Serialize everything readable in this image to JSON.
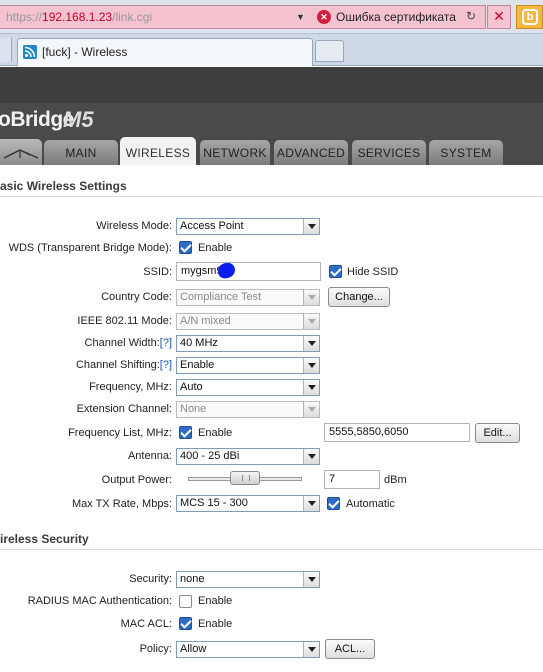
{
  "browser": {
    "url_prefix": "https://",
    "url_host": "192.168.1.23",
    "url_path": "/link.cgi",
    "cert_error": "Ошибка сертификата",
    "tab_title": "[fuck] - Wireless"
  },
  "header": {
    "brand": "oBridge",
    "model": "M5"
  },
  "nav": {
    "tabs": [
      "MAIN",
      "WIRELESS",
      "NETWORK",
      "ADVANCED",
      "SERVICES",
      "SYSTEM"
    ],
    "active": "WIRELESS"
  },
  "basic": {
    "title": "asic Wireless Settings",
    "wireless_mode_label": "Wireless Mode:",
    "wireless_mode_value": "Access Point",
    "wds_label": "WDS (Transparent Bridge Mode):",
    "wds_enable_text": "Enable",
    "ssid_label": "SSID:",
    "ssid_value": "mygsm9",
    "hide_ssid_text": "Hide SSID",
    "country_label": "Country Code:",
    "country_value": "Compliance Test",
    "change_button": "Change...",
    "ieee_label": "IEEE 802.11 Mode:",
    "ieee_value": "A/N mixed",
    "channel_width_label": "Channel Width:",
    "channel_width_help": "[?]",
    "channel_width_value": "40 MHz",
    "channel_shifting_label": "Channel Shifting:",
    "channel_shifting_help": "[?]",
    "channel_shifting_value": "Enable",
    "frequency_label": "Frequency, MHz:",
    "frequency_value": "Auto",
    "extension_label": "Extension Channel:",
    "extension_value": "None",
    "freq_list_label": "Frequency List, MHz:",
    "freq_list_enable_text": "Enable",
    "freq_list_value": "5555,5850,6050",
    "edit_button": "Edit...",
    "antenna_label": "Antenna:",
    "antenna_value": "400 - 25 dBi",
    "output_power_label": "Output Power:",
    "output_power_value": "7",
    "output_power_unit": "dBm",
    "max_tx_label": "Max TX Rate, Mbps:",
    "max_tx_value": "MCS 15 - 300",
    "automatic_text": "Automatic"
  },
  "security": {
    "title": "ireless Security",
    "security_label": "Security:",
    "security_value": "none",
    "radius_label": "RADIUS MAC Authentication:",
    "radius_enable_text": "Enable",
    "mac_acl_label": "MAC ACL:",
    "mac_acl_enable_text": "Enable",
    "policy_label": "Policy:",
    "policy_value": "Allow",
    "acl_button": "ACL..."
  },
  "state": {
    "wds_enabled": true,
    "hide_ssid": true,
    "freq_list_enabled": true,
    "automatic": true,
    "radius_enabled": false,
    "mac_acl_enabled": true,
    "output_power_slider": 0.45
  },
  "icons": {
    "cert": "cert-error-icon",
    "tab": "rss-feed-icon",
    "logo": "ubiquiti-antenna-icon",
    "extension": "toolbar-extension-icon"
  },
  "colors": {
    "url_error_bg": "#f4c3cf",
    "url_host": "#c0002a",
    "header_bg": "#4a4a4a",
    "checkbox_on": "#2f6bc7",
    "help_link": "#1a4fa8"
  }
}
